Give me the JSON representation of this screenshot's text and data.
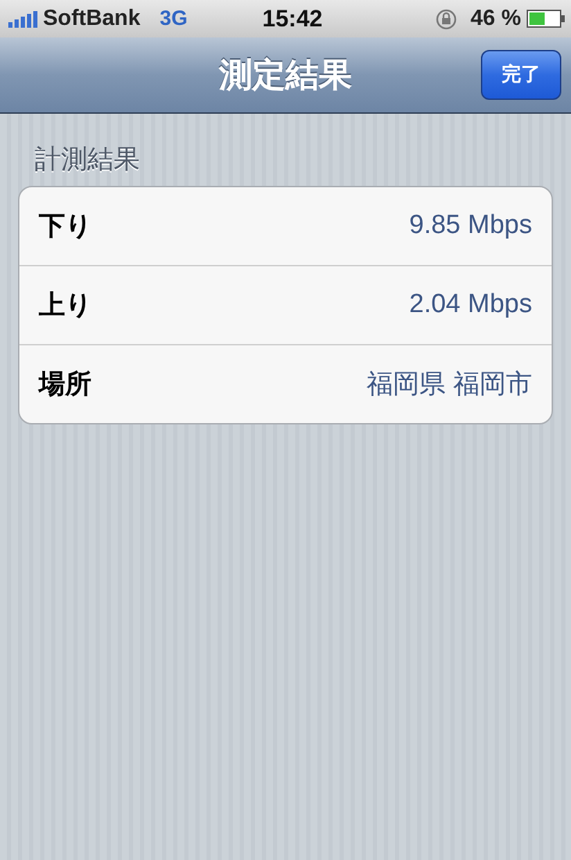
{
  "status_bar": {
    "carrier": "SoftBank",
    "network": "3G",
    "time": "15:42",
    "battery": "46 %"
  },
  "nav_bar": {
    "title": "測定結果",
    "done_button": "完了"
  },
  "section": {
    "header": "計測結果",
    "rows": [
      {
        "label": "下り",
        "value": "9.85 Mbps"
      },
      {
        "label": "上り",
        "value": "2.04 Mbps"
      },
      {
        "label": "場所",
        "value": "福岡県 福岡市"
      }
    ]
  }
}
